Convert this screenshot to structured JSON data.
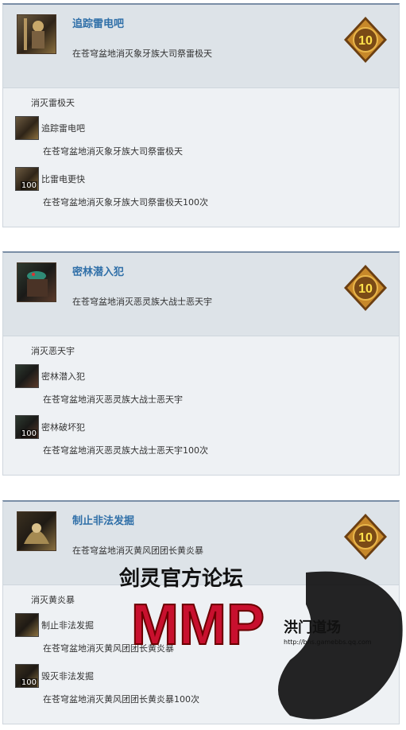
{
  "cards": [
    {
      "title": "追踪雷电吧",
      "desc": "在苍穹盆地消灭象牙族大司祭雷极天",
      "points": "10",
      "section": "消灭雷极天",
      "subs": [
        {
          "name": "追踪雷电吧",
          "desc": "在苍穹盆地消灭象牙族大司祭雷极天",
          "count": ""
        },
        {
          "name": "比雷电更快",
          "desc": "在苍穹盆地消灭象牙族大司祭雷极天100次",
          "count": "100"
        }
      ]
    },
    {
      "title": "密林潜入犯",
      "desc": "在苍穹盆地消灭恶灵族大战士恶天宇",
      "points": "10",
      "section": "消灭恶天宇",
      "subs": [
        {
          "name": "密林潜入犯",
          "desc": "在苍穹盆地消灭恶灵族大战士恶天宇",
          "count": ""
        },
        {
          "name": "密林破坏犯",
          "desc": "在苍穹盆地消灭恶灵族大战士恶天宇100次",
          "count": "100"
        }
      ]
    },
    {
      "title": "制止非法发掘",
      "desc": "在苍穹盆地消灭黄风团团长黄炎暴",
      "points": "10",
      "section": "消灭黄炎暴",
      "subs": [
        {
          "name": "制止非法发掘",
          "desc": "在苍穹盆地消灭黄风团团长黄炎暴",
          "count": ""
        },
        {
          "name": "毁灭非法发掘",
          "desc": "在苍穹盆地消灭黄风团团长黄炎暴100次",
          "count": "100"
        }
      ]
    }
  ],
  "watermark": {
    "forum": "剑灵官方论坛",
    "logo": "MMP",
    "guild": "洪门道场",
    "url": "http://bns.gamebbs.qq.com"
  },
  "colors": {
    "title": "#2f6fa8",
    "header_bg": "#dde3e8",
    "body_bg": "#eef1f4",
    "medal_gold": "#d89a2b"
  }
}
